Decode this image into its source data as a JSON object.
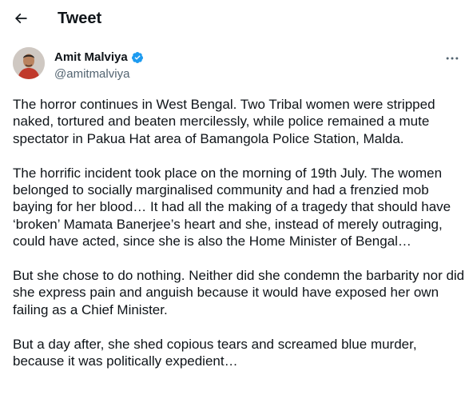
{
  "header": {
    "title": "Tweet",
    "back_icon": "arrow-left-icon"
  },
  "author": {
    "display_name": "Amit Malviya",
    "handle": "@amitmalviya",
    "verified_icon": "verified-badge-icon",
    "more_icon": "more-horizontal-icon"
  },
  "tweet": {
    "paragraphs": [
      "The horror continues in West Bengal. Two Tribal women were stripped naked, tortured and beaten mercilessly, while police remained a mute spectator in Pakua Hat area of Bamangola Police Station, Malda.",
      "The horrific incident took place on the morning of 19th July. The women belonged to socially marginalised community and had a frenzied mob baying for her blood… It had all the making of a tragedy that should have ‘broken’ Mamata Banerjee’s heart and she, instead of merely outraging, could have acted, since she is also the Home Minister of Bengal…",
      "But she chose to do nothing. Neither did she condemn the barbarity nor did she express pain and anguish because it would have exposed her own failing as a Chief Minister.",
      "But a day after, she shed copious tears and screamed blue murder, because it was politically expedient…"
    ]
  },
  "colors": {
    "text": "#0f1419",
    "secondary": "#536471",
    "verified": "#1d9bf0"
  }
}
